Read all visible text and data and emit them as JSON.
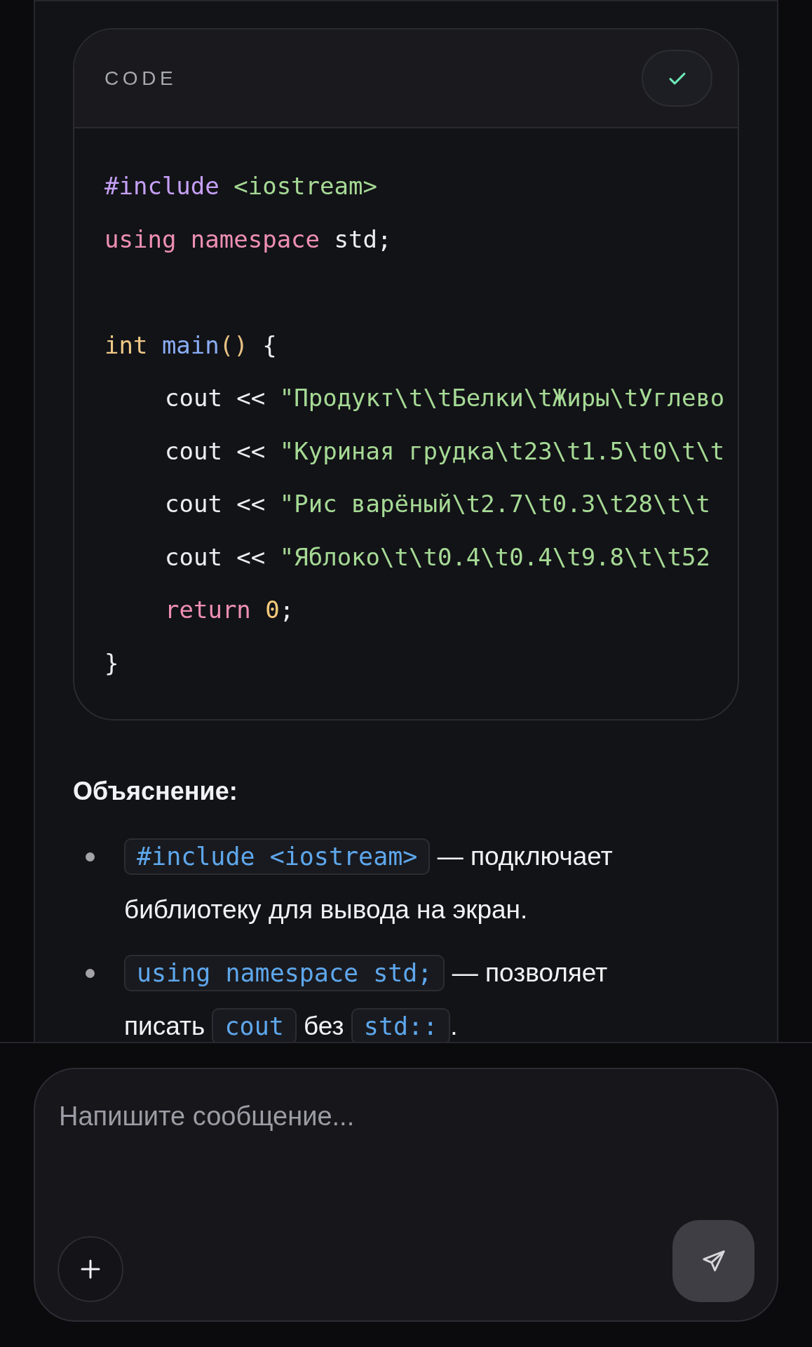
{
  "code_block": {
    "label": "CODE",
    "copied": true,
    "lines": [
      {
        "kind": "code",
        "indented": false,
        "tokens": [
          {
            "kind": "preproc",
            "text": "#include "
          },
          {
            "kind": "string",
            "text": "<iostream>"
          }
        ]
      },
      {
        "kind": "code",
        "indented": false,
        "tokens": [
          {
            "kind": "keyword",
            "text": "using namespace"
          },
          {
            "kind": "plain",
            "text": " std;"
          }
        ]
      },
      {
        "kind": "blank"
      },
      {
        "kind": "code",
        "indented": false,
        "tokens": [
          {
            "kind": "type",
            "text": "int "
          },
          {
            "kind": "function",
            "text": "main"
          },
          {
            "kind": "paren",
            "text": "()"
          },
          {
            "kind": "plain",
            "text": " {"
          }
        ]
      },
      {
        "kind": "code",
        "indented": true,
        "tokens": [
          {
            "kind": "plain",
            "text": "cout << "
          },
          {
            "kind": "string",
            "text": "\"Продукт\\t\\tБелки\\tЖиры\\tУглево"
          }
        ]
      },
      {
        "kind": "code",
        "indented": true,
        "tokens": [
          {
            "kind": "plain",
            "text": "cout << "
          },
          {
            "kind": "string",
            "text": "\"Куриная грудка\\t23\\t1.5\\t0\\t\\t"
          }
        ]
      },
      {
        "kind": "code",
        "indented": true,
        "tokens": [
          {
            "kind": "plain",
            "text": "cout << "
          },
          {
            "kind": "string",
            "text": "\"Рис варёный\\t2.7\\t0.3\\t28\\t\\t"
          }
        ]
      },
      {
        "kind": "code",
        "indented": true,
        "tokens": [
          {
            "kind": "plain",
            "text": "cout << "
          },
          {
            "kind": "string",
            "text": "\"Яблоко\\t\\t0.4\\t0.4\\t9.8\\t\\t52"
          }
        ]
      },
      {
        "kind": "code",
        "indented": true,
        "tokens": [
          {
            "kind": "keyword",
            "text": "return "
          },
          {
            "kind": "number",
            "text": "0"
          },
          {
            "kind": "plain",
            "text": ";"
          }
        ]
      },
      {
        "kind": "code",
        "indented": false,
        "tokens": [
          {
            "kind": "plain",
            "text": "}"
          }
        ]
      }
    ]
  },
  "explanation": {
    "heading": "Объяснение:",
    "items": [
      {
        "parts": [
          {
            "kind": "code",
            "text": "#include <iostream>"
          },
          {
            "kind": "text",
            "text": " — подключает библиотеку для вывода на экран."
          }
        ]
      },
      {
        "parts": [
          {
            "kind": "code",
            "text": "using namespace std;"
          },
          {
            "kind": "text",
            "text": " — позволяет писать "
          },
          {
            "kind": "code",
            "text": "cout"
          },
          {
            "kind": "text",
            "text": " без "
          },
          {
            "kind": "code",
            "text": "std::"
          },
          {
            "kind": "text",
            "text": "."
          }
        ]
      }
    ]
  },
  "composer": {
    "placeholder": "Напишите сообщение..."
  }
}
